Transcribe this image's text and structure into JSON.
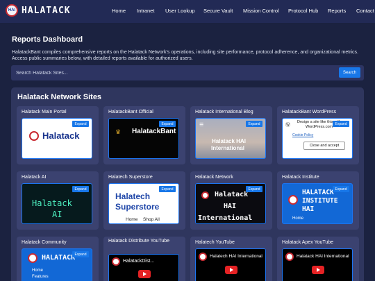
{
  "brand": {
    "name": "HALATACK",
    "badge_text": "HAI"
  },
  "nav": {
    "links": [
      "Home",
      "Intranet",
      "User Lookup",
      "Secure Vault",
      "Mission Control",
      "Protocol Hub",
      "Reports",
      "Contact"
    ]
  },
  "page": {
    "title": "Reports Dashboard",
    "intro_line1": "HalatackBant compiles comprehensive reports on the Halatack Network's operations, including site performance, protocol adherence, and organizational metrics.",
    "intro_line2": "Access public summaries below, with detailed reports available for authorized users."
  },
  "search": {
    "placeholder": "Search Halatack Sites...",
    "button_label": "Search"
  },
  "sites_panel": {
    "title": "Halatack Network Sites",
    "expand_label": "Expand",
    "cards": [
      {
        "title": "Halatack Main Portal",
        "preview": {
          "text": "Halatack"
        }
      },
      {
        "title": "HalatackBant Official",
        "preview": {
          "text": "HalatackBant"
        }
      },
      {
        "title": "Halatack International Blog",
        "preview": {
          "text_line1": "Halatack HAI",
          "text_line2": "International"
        }
      },
      {
        "title": "HalatackBant WordPress",
        "preview": {
          "text_line1": "Design a site like this with",
          "text_line2": "WordPress.com",
          "cookie_policy": "Cookie Policy",
          "accept": "Close and accept"
        }
      },
      {
        "title": "Halatack AI",
        "preview": {
          "text_line1": "Halatack",
          "text_line2": "AI"
        }
      },
      {
        "title": "Halatech Superstore",
        "preview": {
          "text_line1": "Halatech",
          "text_line2": "Superstore",
          "menu_home": "Home",
          "menu_shop": "Shop All"
        }
      },
      {
        "title": "Halatack Network",
        "preview": {
          "text_line1": "Halatack",
          "text_line2": "HAI",
          "text_line3": "International"
        }
      },
      {
        "title": "Halatack Institute",
        "preview": {
          "text_line1": "HALATACK",
          "text_line2": "INSTITUTE",
          "text_line3": "HAI",
          "menu_home": "Home"
        }
      },
      {
        "title": "Halatack Community",
        "preview": {
          "text": "HALATACK",
          "menu_home": "Home",
          "menu_features": "Features"
        }
      },
      {
        "title": "Halatack Distribute YouTube",
        "preview": {
          "text": "HalatackDist..."
        }
      },
      {
        "title": "Halatech YouTube",
        "preview": {
          "text": "Halatech HAI International"
        }
      },
      {
        "title": "Halatack Apex YouTube",
        "preview": {
          "text": "Halatack HAI International"
        }
      }
    ]
  },
  "colors": {
    "background": "#1b2240",
    "nav": "#222a55",
    "panel": "#2f365e",
    "card": "#3b4270",
    "accent": "#1877e8",
    "brand_red": "#c92a32"
  }
}
